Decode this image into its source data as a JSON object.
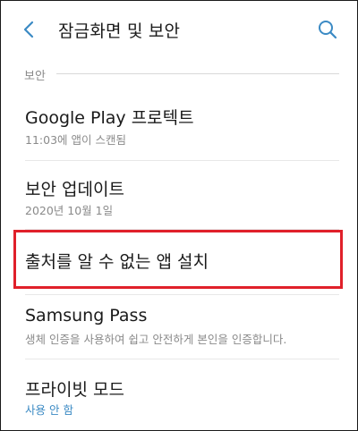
{
  "header": {
    "title": "잠금화면 및 보안",
    "back_icon": "chevron-left-icon",
    "search_icon": "search-icon",
    "accent": "#3b8ac4"
  },
  "section": {
    "label": "보안"
  },
  "items": [
    {
      "title": "Google Play 프로텍트",
      "subtitle": "11:03에 앱이 스캔됨"
    },
    {
      "title": "보안 업데이트",
      "subtitle": "2020년 10월 1일"
    },
    {
      "title": "출처를 알 수 없는 앱 설치",
      "subtitle": ""
    },
    {
      "title": "Samsung Pass",
      "subtitle": "생체 인증을 사용하여 쉽고 안전하게 본인을 인증합니다."
    },
    {
      "title": "프라이빗 모드",
      "subtitle": "사용 안 함"
    }
  ],
  "highlight_color": "#e0202a"
}
